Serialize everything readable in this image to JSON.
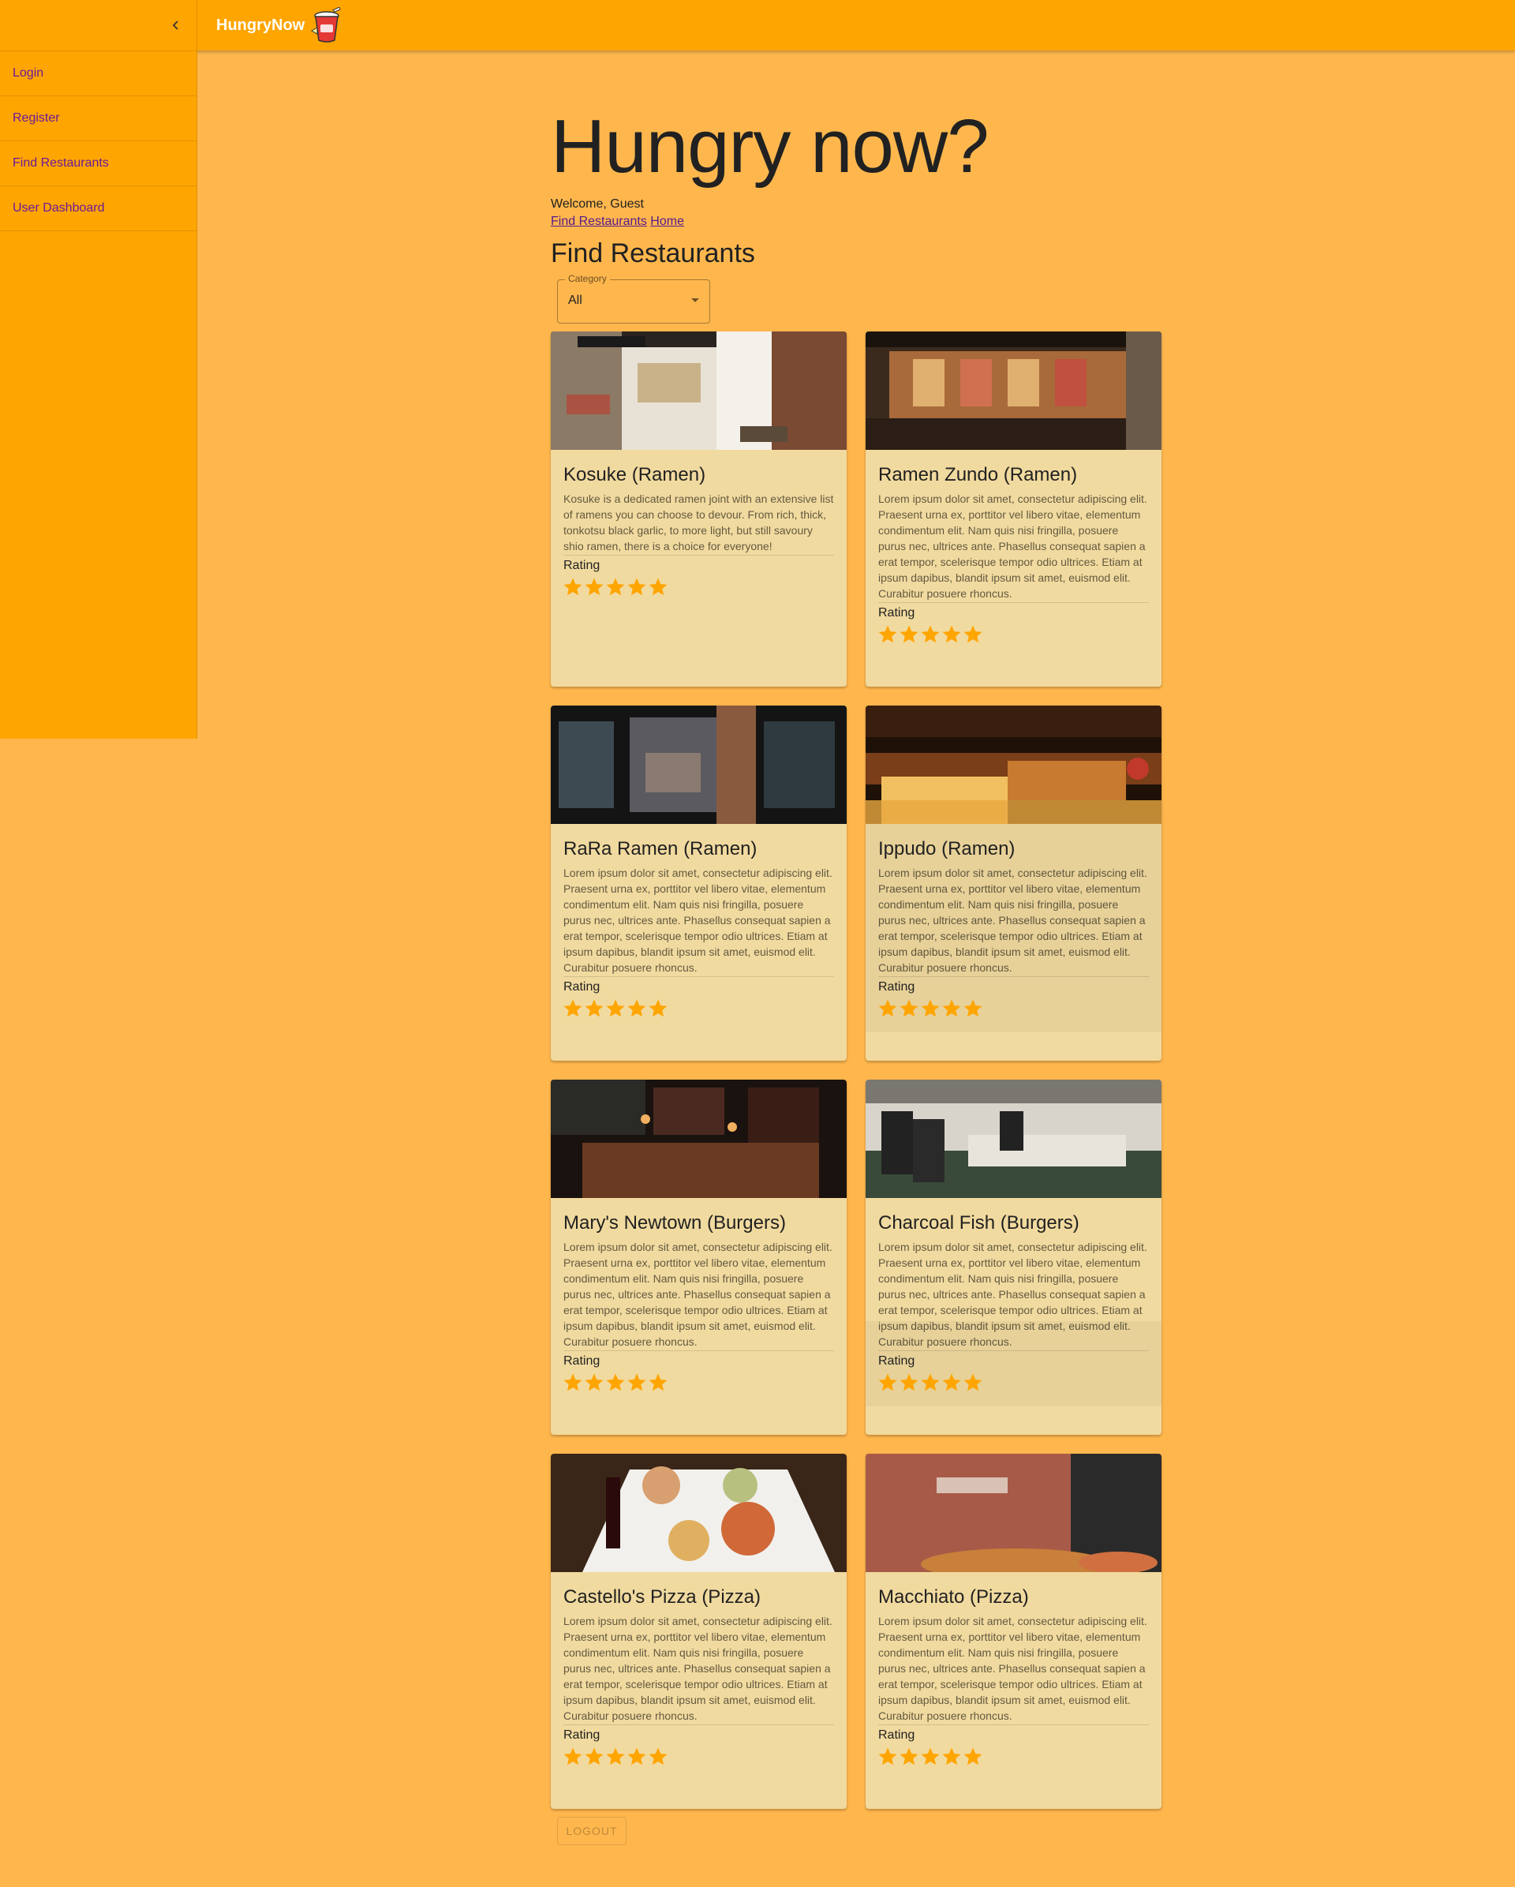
{
  "app": {
    "brand": "HungryNow"
  },
  "drawer": {
    "items": [
      {
        "label": "Login"
      },
      {
        "label": "Register"
      },
      {
        "label": "Find Restaurants"
      },
      {
        "label": "User Dashboard"
      }
    ]
  },
  "main": {
    "hero": "Hungry now?",
    "welcome": "Welcome, Guest",
    "links": [
      {
        "label": "Find Restaurants"
      },
      {
        "label": "Home"
      }
    ],
    "section_title": "Find Restaurants",
    "category": {
      "label": "Category",
      "value": "All"
    },
    "rating_label": "Rating",
    "logout_label": "LOGOUT"
  },
  "restaurants": [
    {
      "title": "Kosuke (Ramen)",
      "description": "Kosuke is a dedicated ramen joint with an extensive list of ramens you can choose to devour. From rich, thick, tonkotsu black garlic, to more light, but still savoury shio ramen, there is a choice for everyone!",
      "rating": 5
    },
    {
      "title": "Ramen Zundo (Ramen)",
      "description": "Lorem ipsum dolor sit amet, consectetur adipiscing elit. Praesent urna ex, porttitor vel libero vitae, elementum condimentum elit. Nam quis nisi fringilla, posuere purus nec, ultrices ante. Phasellus consequat sapien a erat tempor, scelerisque tempor odio ultrices. Etiam at ipsum dapibus, blandit ipsum sit amet, euismod elit. Curabitur posuere rhoncus.",
      "rating": 5
    },
    {
      "title": "RaRa Ramen (Ramen)",
      "description": "Lorem ipsum dolor sit amet, consectetur adipiscing elit. Praesent urna ex, porttitor vel libero vitae, elementum condimentum elit. Nam quis nisi fringilla, posuere purus nec, ultrices ante. Phasellus consequat sapien a erat tempor, scelerisque tempor odio ultrices. Etiam at ipsum dapibus, blandit ipsum sit amet, euismod elit. Curabitur posuere rhoncus.",
      "rating": 5
    },
    {
      "title": "Ippudo (Ramen)",
      "description": "Lorem ipsum dolor sit amet, consectetur adipiscing elit. Praesent urna ex, porttitor vel libero vitae, elementum condimentum elit. Nam quis nisi fringilla, posuere purus nec, ultrices ante. Phasellus consequat sapien a erat tempor, scelerisque tempor odio ultrices. Etiam at ipsum dapibus, blandit ipsum sit amet, euismod elit. Curabitur posuere rhoncus.",
      "rating": 5
    },
    {
      "title": "Mary's Newtown (Burgers)",
      "description": "Lorem ipsum dolor sit amet, consectetur adipiscing elit. Praesent urna ex, porttitor vel libero vitae, elementum condimentum elit. Nam quis nisi fringilla, posuere purus nec, ultrices ante. Phasellus consequat sapien a erat tempor, scelerisque tempor odio ultrices. Etiam at ipsum dapibus, blandit ipsum sit amet, euismod elit. Curabitur posuere rhoncus.",
      "rating": 5
    },
    {
      "title": "Charcoal Fish (Burgers)",
      "description": "Lorem ipsum dolor sit amet, consectetur adipiscing elit. Praesent urna ex, porttitor vel libero vitae, elementum condimentum elit. Nam quis nisi fringilla, posuere purus nec, ultrices ante. Phasellus consequat sapien a erat tempor, scelerisque tempor odio ultrices. Etiam at ipsum dapibus, blandit ipsum sit amet, euismod elit. Curabitur posuere rhoncus.",
      "rating": 5
    },
    {
      "title": "Castello's Pizza (Pizza)",
      "description": "Lorem ipsum dolor sit amet, consectetur adipiscing elit. Praesent urna ex, porttitor vel libero vitae, elementum condimentum elit. Nam quis nisi fringilla, posuere purus nec, ultrices ante. Phasellus consequat sapien a erat tempor, scelerisque tempor odio ultrices. Etiam at ipsum dapibus, blandit ipsum sit amet, euismod elit. Curabitur posuere rhoncus.",
      "rating": 5
    },
    {
      "title": "Macchiato (Pizza)",
      "description": "Lorem ipsum dolor sit amet, consectetur adipiscing elit. Praesent urna ex, porttitor vel libero vitae, elementum condimentum elit. Nam quis nisi fringilla, posuere purus nec, ultrices ante. Phasellus consequat sapien a erat tempor, scelerisque tempor odio ultrices. Etiam at ipsum dapibus, blandit ipsum sit amet, euismod elit. Curabitur posuere rhoncus.",
      "rating": 5
    }
  ],
  "colors": {
    "primary": "#FFA500",
    "background": "#FFB74D",
    "card": "#F1DA9F",
    "star": "#FFA500",
    "link": "#551A8B",
    "nav_text": "#6A1B9A"
  }
}
